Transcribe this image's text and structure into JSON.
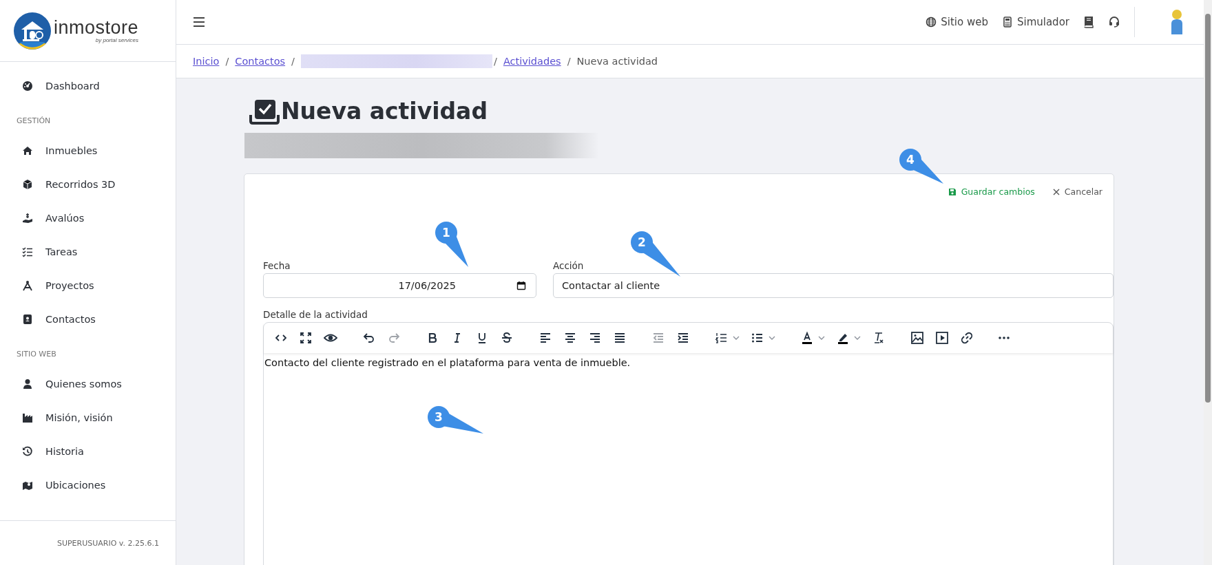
{
  "logo": {
    "name": "inmostore",
    "tagline": "by portal services"
  },
  "sidebar": {
    "sections": [
      {
        "items": [
          {
            "label": "Dashboard",
            "selected": false
          }
        ]
      },
      {
        "heading": "GESTIÓN",
        "items": [
          {
            "label": "Inmuebles",
            "selected": false
          },
          {
            "label": "Recorridos 3D",
            "selected": false
          },
          {
            "label": "Avalúos",
            "selected": false
          },
          {
            "label": "Tareas",
            "selected": false
          },
          {
            "label": "Proyectos",
            "selected": false
          },
          {
            "label": "Contactos",
            "selected": false
          }
        ]
      },
      {
        "heading": "SITIO WEB",
        "items": [
          {
            "label": "Quienes somos",
            "selected": false
          },
          {
            "label": "Misión, visión",
            "selected": false
          },
          {
            "label": "Historia",
            "selected": false
          },
          {
            "label": "Ubicaciones",
            "selected": false
          }
        ]
      }
    ],
    "footer": "SUPERUSUARIO v. 2.25.6.1"
  },
  "header": {
    "links": [
      {
        "label": "Sitio web"
      },
      {
        "label": "Simulador"
      }
    ]
  },
  "breadcrumb": [
    {
      "kind": "link",
      "label": "Inicio"
    },
    {
      "kind": "link",
      "separator": "/",
      "label": "Contactos"
    },
    {
      "kind": "redacted",
      "separator": "/"
    },
    {
      "kind": "link",
      "separator": "/",
      "label": "Actividades"
    },
    {
      "kind": "current",
      "separator": "/",
      "label": "Nueva actividad"
    }
  ],
  "page": {
    "title": "Nueva actividad",
    "subtitle": {
      "kind": "redacted"
    }
  },
  "actions": [
    {
      "kind": "save",
      "label": "Guardar cambios"
    },
    {
      "kind": "cancel",
      "label": "Cancelar"
    }
  ],
  "form": {
    "fecha": {
      "label": "Fecha",
      "value": "17/06/2025"
    },
    "accion": {
      "label": "Acción",
      "value": "Contactar al cliente"
    },
    "detalle": {
      "label": "Detalle de la actividad",
      "text": "Contacto del cliente registrado en el plataforma para venta de inmueble.",
      "toolbar_groups": [
        {
          "tools": [
            {
              "kind": "code",
              "disabled": false
            },
            {
              "kind": "fullscreen",
              "disabled": false
            },
            {
              "kind": "preview",
              "disabled": false
            }
          ]
        },
        {
          "tools": [
            {
              "kind": "undo",
              "disabled": false
            },
            {
              "kind": "redo",
              "disabled": true
            }
          ]
        },
        {
          "tools": [
            {
              "kind": "bold",
              "disabled": false
            },
            {
              "kind": "italic",
              "disabled": false
            },
            {
              "kind": "underline",
              "disabled": false
            },
            {
              "kind": "strike",
              "disabled": false
            }
          ]
        },
        {
          "tools": [
            {
              "kind": "alignleft",
              "disabled": false
            },
            {
              "kind": "aligncenter",
              "disabled": false
            },
            {
              "kind": "alignright",
              "disabled": false
            },
            {
              "kind": "justify",
              "disabled": false
            }
          ]
        },
        {
          "tools": [
            {
              "kind": "outdent",
              "disabled": true
            },
            {
              "kind": "indent",
              "disabled": false
            }
          ]
        },
        {
          "tools": [
            {
              "kind": "numlist",
              "disabled": false,
              "dropdown": true
            },
            {
              "kind": "bullist",
              "disabled": false,
              "dropdown": true
            }
          ]
        },
        {
          "tools": [
            {
              "kind": "forecolor",
              "disabled": false,
              "dropdown": true
            },
            {
              "kind": "highlight",
              "disabled": false,
              "dropdown": true
            },
            {
              "kind": "clearformat",
              "disabled": false
            }
          ]
        },
        {
          "tools": [
            {
              "kind": "image",
              "disabled": false
            },
            {
              "kind": "media",
              "disabled": false
            },
            {
              "kind": "link",
              "disabled": false
            }
          ]
        },
        {
          "tools": [
            {
              "kind": "more",
              "disabled": false
            }
          ]
        }
      ]
    }
  },
  "callouts": [
    {
      "label": "1"
    },
    {
      "label": "2"
    },
    {
      "label": "3"
    },
    {
      "label": "4"
    }
  ]
}
